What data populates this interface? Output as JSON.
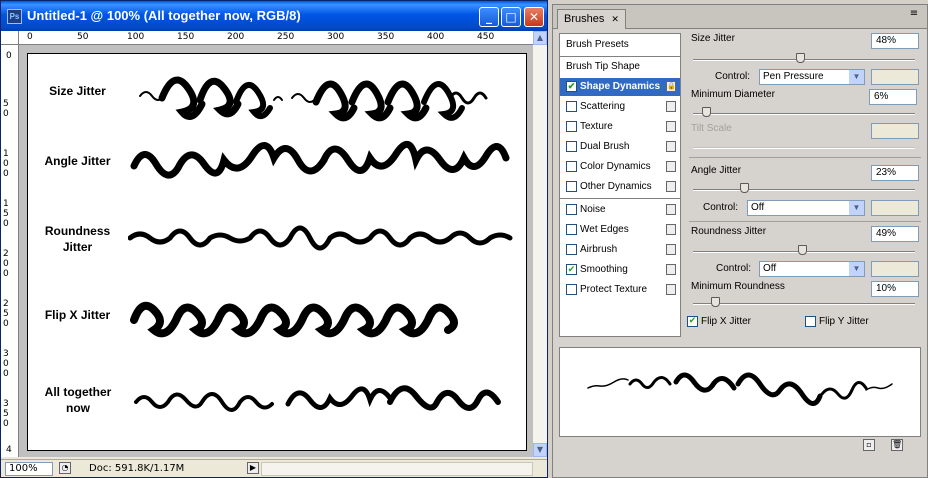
{
  "document_window": {
    "title": "Untitled-1 @ 100% (All together now, RGB/8)",
    "app_icon": "Ps",
    "buttons": {
      "minimize": "_",
      "maximize": "□",
      "close": "✕"
    },
    "ruler_h": [
      "0",
      "50",
      "100",
      "150",
      "200",
      "250",
      "300",
      "350",
      "400",
      "450"
    ],
    "ruler_v": [
      "0",
      "50",
      "100",
      "150",
      "200",
      "250",
      "300",
      "350",
      "4"
    ],
    "canvas_rows": [
      {
        "label": "Size Jitter"
      },
      {
        "label": "Angle Jitter"
      },
      {
        "label": "Roundness Jitter"
      },
      {
        "label": "Flip X Jitter"
      },
      {
        "label": "All together now"
      }
    ],
    "status": {
      "zoom": "100%",
      "doc": "Doc: 591.8K/1.17M"
    }
  },
  "brushes_panel": {
    "tab": "Brushes",
    "tab_close": "✕",
    "menu_icon": "≡",
    "presets_label": "Brush Presets",
    "tip_shape_label": "Brush Tip Shape",
    "settings": [
      {
        "label": "Shape Dynamics",
        "checked": true,
        "selected": true
      },
      {
        "label": "Scattering",
        "checked": false
      },
      {
        "label": "Texture",
        "checked": false
      },
      {
        "label": "Dual Brush",
        "checked": false
      },
      {
        "label": "Color Dynamics",
        "checked": false
      },
      {
        "label": "Other Dynamics",
        "checked": false
      }
    ],
    "extras": [
      {
        "label": "Noise",
        "checked": false
      },
      {
        "label": "Wet Edges",
        "checked": false
      },
      {
        "label": "Airbrush",
        "checked": false
      },
      {
        "label": "Smoothing",
        "checked": true
      },
      {
        "label": "Protect Texture",
        "checked": false
      }
    ],
    "options": {
      "size_jitter_label": "Size Jitter",
      "size_jitter_value": "48%",
      "size_jitter_level": 0.48,
      "control1_label": "Control:",
      "control1_value": "Pen Pressure",
      "min_diameter_label": "Minimum Diameter",
      "min_diameter_value": "6%",
      "min_diameter_level": 0.06,
      "tilt_scale_label": "Tilt Scale",
      "angle_jitter_label": "Angle Jitter",
      "angle_jitter_value": "23%",
      "angle_jitter_level": 0.23,
      "control2_label": "Control:",
      "control2_value": "Off",
      "roundness_jitter_label": "Roundness Jitter",
      "roundness_jitter_value": "49%",
      "roundness_jitter_level": 0.49,
      "control3_label": "Control:",
      "control3_value": "Off",
      "min_roundness_label": "Minimum Roundness",
      "min_roundness_value": "10%",
      "min_roundness_level": 0.1,
      "flip_x_label": "Flip X Jitter",
      "flip_x_checked": true,
      "flip_y_label": "Flip Y Jitter",
      "flip_y_checked": false
    }
  },
  "colors": {
    "title_blue": "#0055e5",
    "selection_blue": "#316ac5",
    "check_green": "#21a121"
  }
}
